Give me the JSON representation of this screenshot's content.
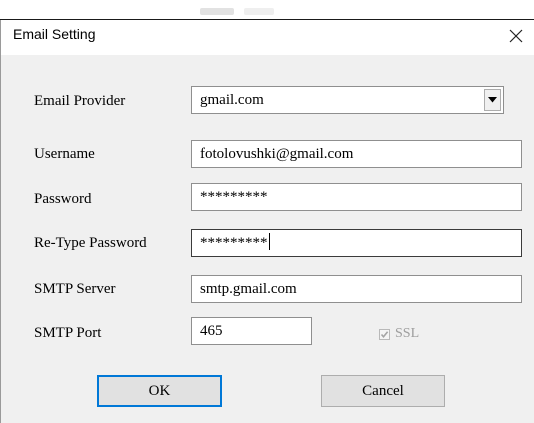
{
  "window": {
    "title": "Email Setting",
    "close_glyph": "✕"
  },
  "form": {
    "provider": {
      "label": "Email Provider",
      "value": "gmail.com",
      "dropdown_icon": "chevron-down-icon"
    },
    "username": {
      "label": "Username",
      "value": "fotolovushki@gmail.com"
    },
    "password": {
      "label": "Password",
      "value": "*********"
    },
    "retype_password": {
      "label": "Re-Type Password",
      "value": "*********"
    },
    "smtp_server": {
      "label": "SMTP Server",
      "value": "smtp.gmail.com"
    },
    "smtp_port": {
      "label": "SMTP Port",
      "value": "465"
    },
    "ssl": {
      "label": "SSL",
      "checked": true,
      "disabled": true
    }
  },
  "buttons": {
    "ok_label": "OK",
    "cancel_label": "Cancel"
  },
  "colors": {
    "dialog_bg": "#f0f0f0",
    "titlebar_bg": "#ffffff",
    "focus_border": "#0078d7",
    "disabled_text": "#9d9d9d"
  }
}
